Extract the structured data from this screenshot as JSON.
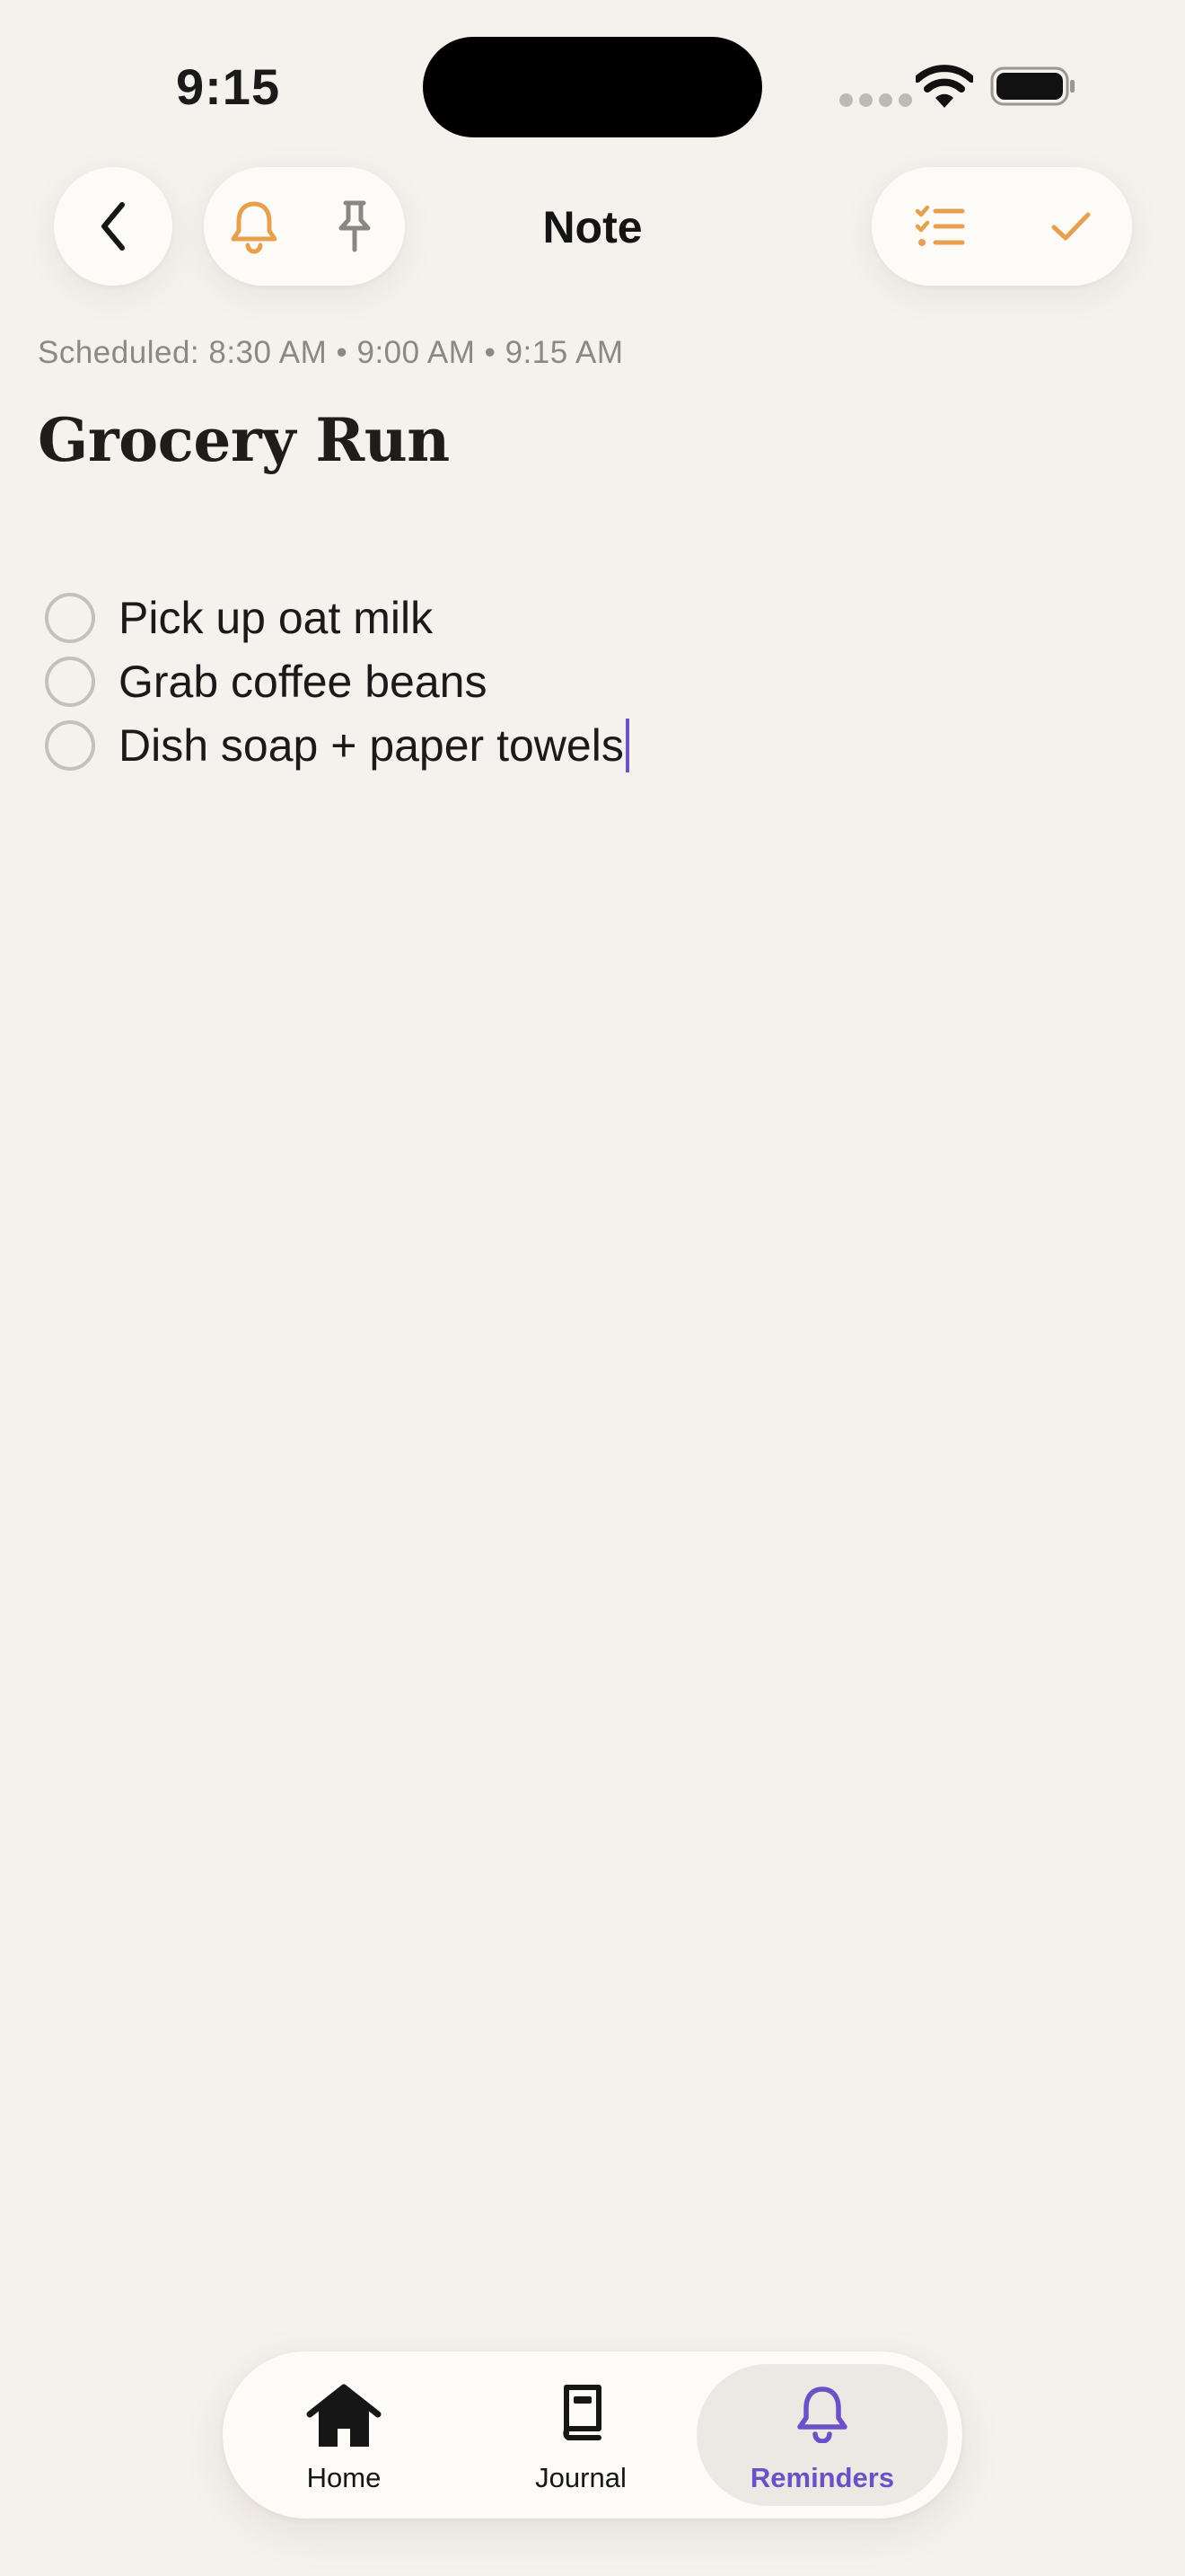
{
  "status_bar": {
    "time": "9:15"
  },
  "nav": {
    "title": "Note",
    "icons": [
      "back-chevron-icon",
      "bell-icon",
      "pin-icon",
      "checklist-icon",
      "checkmark-icon"
    ]
  },
  "note": {
    "scheduled": "Scheduled: 8:30 AM • 9:00 AM • 9:15 AM",
    "title": "Grocery Run",
    "items": [
      {
        "text": "Pick up oat milk",
        "checked": false
      },
      {
        "text": "Grab coffee beans",
        "checked": false
      },
      {
        "text": "Dish soap + paper towels",
        "checked": false
      }
    ]
  },
  "tab_bar": {
    "tabs": [
      {
        "label": "Home",
        "icon": "house-icon"
      },
      {
        "label": "Journal",
        "icon": "book-icon"
      },
      {
        "label": "Reminders",
        "icon": "bell-icon"
      }
    ],
    "active": "Reminders"
  },
  "colors": {
    "background": "#f5f1ec",
    "accent_orange": "#e7a04e",
    "accent_purple": "#6a52c6",
    "surface": "#fdfbf7"
  }
}
